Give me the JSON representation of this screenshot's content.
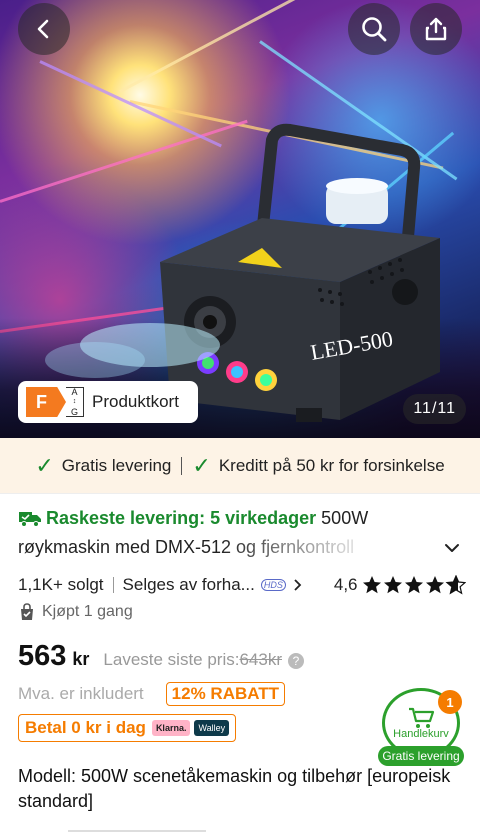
{
  "header": {
    "back_icon": "chevron-left-icon",
    "search_icon": "search-icon",
    "share_icon": "share-icon"
  },
  "hero": {
    "machine_label": "LED-500",
    "image_counter": "11/11",
    "energy_label": {
      "class": "F",
      "scale_top": "A",
      "scale_bottom": "G",
      "text": "Produktkort"
    }
  },
  "benefits": {
    "item1": "Gratis levering",
    "item2": "Kreditt på 50 kr for forsinkelse"
  },
  "title": {
    "delivery": "Raskeste levering: 5 virkedager",
    "line1_rest": "500W",
    "line2": "røykmaskin med DMX-512 og fjernkontroll"
  },
  "stats": {
    "sold": "1,1K+ solgt",
    "seller": "Selges av forha...",
    "seller_badge": "HDS",
    "rating": "4,6",
    "stars": 4.6
  },
  "bought": "Kjøpt 1 gang",
  "price": {
    "amount": "563",
    "currency": "kr",
    "lowest_label": "Laveste siste pris:",
    "old_price": "643kr"
  },
  "vat": "Mva. er inkludert",
  "discount": "12% RABATT",
  "pay": {
    "text": "Betal 0 kr i dag",
    "klarna": "Klarna.",
    "walley": "Walley"
  },
  "cart": {
    "label": "Handlekurv",
    "count": "1",
    "free": "Gratis levering"
  },
  "model": "Modell: 500W scenetåkemaskin og tilbehør [europeisk standard]",
  "colors": {
    "green": "#1a8a2e",
    "orange": "#f57c00",
    "benefits_bg": "#fdf3e6"
  }
}
